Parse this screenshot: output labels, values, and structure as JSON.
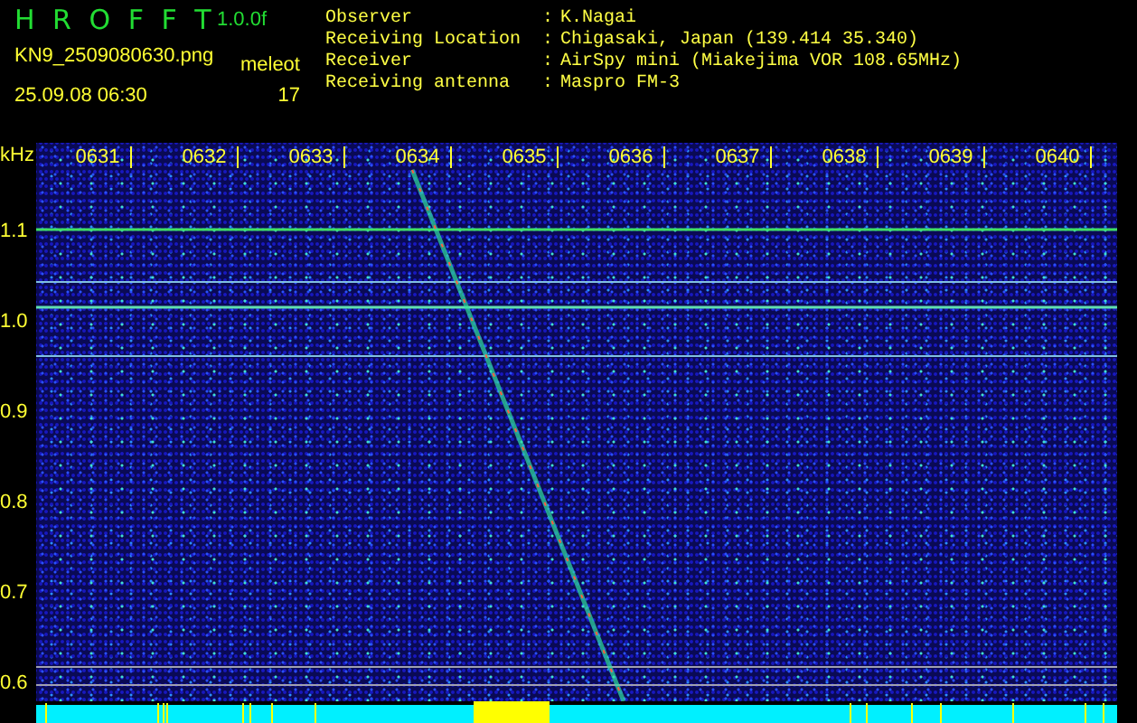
{
  "header": {
    "title": "H R O F F T",
    "version": "1.0.0f",
    "filename": "KN9_2509080630.png",
    "count_label": "meleot",
    "datetime": "25.09.08 06:30",
    "count": "17"
  },
  "info": [
    {
      "label": "Observer",
      "separator": ":",
      "value": "K.Nagai"
    },
    {
      "label": "Receiving Location",
      "separator": ":",
      "value": "Chigasaki, Japan (139.414 35.340)"
    },
    {
      "label": "Receiver",
      "separator": ":",
      "value": "AirSpy mini (Miakejima VOR 108.65MHz)"
    },
    {
      "label": "Receiving antenna",
      "separator": ":",
      "value": "Maspro FM-3"
    }
  ],
  "spectrogram": {
    "unit": "kHz",
    "freq_labels": [
      "1.1",
      "1.0",
      "0.9",
      "0.8",
      "0.7",
      "0.6"
    ],
    "time_labels": [
      "0631",
      "0632",
      "0633",
      "0634",
      "0635",
      "0636",
      "0637",
      "0638",
      "0639",
      "0640"
    ]
  }
}
